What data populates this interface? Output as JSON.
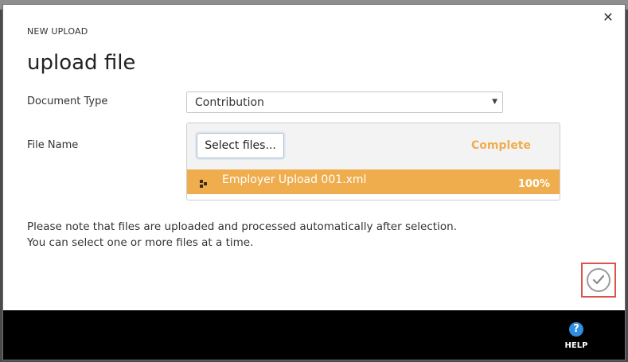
{
  "dialog": {
    "subtitle": "NEW UPLOAD",
    "title": "upload file",
    "close_icon": "close-icon"
  },
  "form": {
    "document_type_label": "Document Type",
    "document_type_value": "Contribution",
    "file_name_label": "File Name"
  },
  "upload": {
    "select_button_label": "Select files...",
    "status_text": "Complete",
    "status_color": "#f0ad4e",
    "files": [
      {
        "name": "Employer Upload 001.xml",
        "progress": "100%",
        "icon": "file-icon"
      }
    ],
    "row_color": "#efad4d"
  },
  "note": {
    "line1": "Please note that files are uploaded and processed automatically after selection.",
    "line2": "You can select one or more files at a time."
  },
  "actions": {
    "confirm_icon": "checkmark-icon",
    "highlight_color": "#d9534f"
  },
  "footer": {
    "help_icon": "question-icon",
    "help_label": "HELP",
    "help_color": "#2f8ee0"
  }
}
